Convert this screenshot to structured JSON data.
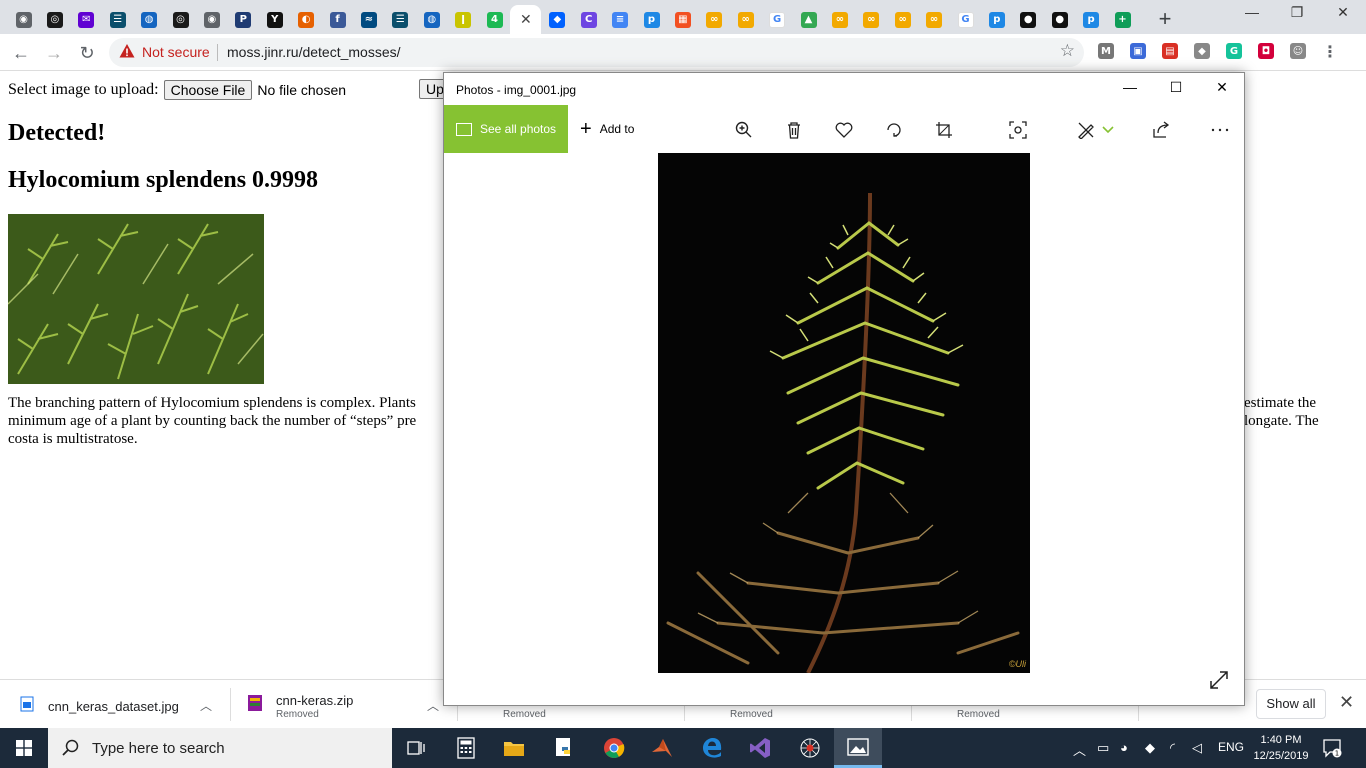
{
  "browser": {
    "tabs": [
      {
        "icon": "globe-icon",
        "color": "#5f6368",
        "glyph": "◉"
      },
      {
        "icon": "camera-lens-icon",
        "color": "#1a1a1a",
        "glyph": "◎"
      },
      {
        "icon": "mail-icon",
        "color": "#6001d2",
        "glyph": "✉"
      },
      {
        "icon": "ice-icon",
        "color": "#0b4f6c",
        "glyph": "☰"
      },
      {
        "icon": "earth-icon",
        "color": "#1565c0",
        "glyph": "◍"
      },
      {
        "icon": "camera-lens-icon",
        "color": "#1a1a1a",
        "glyph": "◎"
      },
      {
        "icon": "globe-icon",
        "color": "#5f6368",
        "glyph": "◉"
      },
      {
        "icon": "p-icon",
        "color": "#1f3b73",
        "glyph": "P"
      },
      {
        "icon": "y-icon",
        "color": "#111111",
        "glyph": "Y"
      },
      {
        "icon": "firefox-icon",
        "color": "#e66000",
        "glyph": "◐"
      },
      {
        "icon": "facebook-icon",
        "color": "#3b5998",
        "glyph": "f"
      },
      {
        "icon": "ship-icon",
        "color": "#004a80",
        "glyph": "≈"
      },
      {
        "icon": "ice-icon",
        "color": "#0b4f6c",
        "glyph": "☰"
      },
      {
        "icon": "earth-icon",
        "color": "#1565c0",
        "glyph": "◍"
      },
      {
        "icon": "yellow-icon",
        "color": "#c9c400",
        "glyph": "ǀ"
      },
      {
        "icon": "sheets-icon",
        "color": "#1db954",
        "glyph": "4"
      },
      {
        "icon": "close-icon",
        "color": "#ffffff",
        "glyph": "✕"
      },
      {
        "icon": "dropbox-icon",
        "color": "#0061fe",
        "glyph": "◆"
      },
      {
        "icon": "c-icon",
        "color": "#6e45e2",
        "glyph": "C"
      },
      {
        "icon": "docs-icon",
        "color": "#4285f4",
        "glyph": "≡"
      },
      {
        "icon": "p-blue-icon",
        "color": "#1e88e5",
        "glyph": "p"
      },
      {
        "icon": "microsoft-icon",
        "color": "#f25022",
        "glyph": "▦"
      },
      {
        "icon": "infinity-icon",
        "color": "#f2a900",
        "glyph": "∞"
      },
      {
        "icon": "infinity-icon",
        "color": "#f2a900",
        "glyph": "∞"
      },
      {
        "icon": "google-icon",
        "color": "#ffffff",
        "glyph": "G"
      },
      {
        "icon": "drive-icon",
        "color": "#34a853",
        "glyph": "▲"
      },
      {
        "icon": "infinity-icon",
        "color": "#f2a900",
        "glyph": "∞"
      },
      {
        "icon": "infinity-icon",
        "color": "#f2a900",
        "glyph": "∞"
      },
      {
        "icon": "infinity-icon",
        "color": "#f2a900",
        "glyph": "∞"
      },
      {
        "icon": "infinity-icon",
        "color": "#f2a900",
        "glyph": "∞"
      },
      {
        "icon": "google-icon",
        "color": "#ffffff",
        "glyph": "G"
      },
      {
        "icon": "p-blue-icon",
        "color": "#1e88e5",
        "glyph": "p"
      },
      {
        "icon": "github-icon",
        "color": "#111111",
        "glyph": "●"
      },
      {
        "icon": "github-icon",
        "color": "#111111",
        "glyph": "●"
      },
      {
        "icon": "p-blue-icon",
        "color": "#1e88e5",
        "glyph": "p"
      },
      {
        "icon": "plus-green-icon",
        "color": "#0f9d58",
        "glyph": "+"
      }
    ],
    "new_tab": "+",
    "window_controls": {
      "minimize": "—",
      "restore": "❐",
      "close": "✕"
    },
    "nav": {
      "back": "←",
      "forward": "→",
      "reload": "↻"
    },
    "security": "Not secure",
    "url": "moss.jinr.ru/detect_mosses/",
    "extensions": [
      {
        "icon": "m-icon",
        "color": "#777777",
        "glyph": "M"
      },
      {
        "icon": "camera-icon",
        "color": "#3c6ad8",
        "glyph": "▣"
      },
      {
        "icon": "red-ext-icon",
        "color": "#d93025",
        "glyph": "▤"
      },
      {
        "icon": "dropbox-icon",
        "color": "#888888",
        "glyph": "◆"
      },
      {
        "icon": "grammarly-icon",
        "color": "#15c39a",
        "glyph": "G"
      },
      {
        "icon": "pocket-icon",
        "color": "#d3003b",
        "glyph": "◘"
      },
      {
        "icon": "profile-icon",
        "color": "#888888",
        "glyph": "☺"
      },
      {
        "icon": "menu-icon",
        "color": "#5f6368",
        "glyph": "⋮"
      }
    ]
  },
  "page": {
    "upload_label": "Select image to upload:",
    "choose_file": "Choose File",
    "no_file": "No file chosen",
    "upload_button": "Up",
    "detected": "Detected!",
    "result": "Hylocomium splendens 0.9998",
    "description_left": "The branching pattern of Hylocomium splendens is complex. Plants",
    "description_left_2": "minimum age of a plant by counting back the number of “steps” pre",
    "description_left_3": "costa is multistratose.",
    "description_right_1": "estimate the",
    "description_right_2": "longate. The"
  },
  "downloads": {
    "items": [
      {
        "name": "cnn_keras_dataset.jpg",
        "sub": ""
      },
      {
        "name": "cnn-keras.zip",
        "sub": "Removed"
      },
      {
        "name": "",
        "sub": "Removed"
      },
      {
        "name": "",
        "sub": "Removed"
      },
      {
        "name": "",
        "sub": "Removed"
      }
    ],
    "show_all": "Show all",
    "close": "✕"
  },
  "photos": {
    "title": "Photos - img_0001.jpg",
    "see_all": "See all photos",
    "add_to": "Add to",
    "watermark": "©Uli",
    "controls": {
      "minimize": "—",
      "maximize": "☐",
      "close": "✕"
    }
  },
  "taskbar": {
    "search_placeholder": "Type here to search",
    "time": "1:40 PM",
    "date": "12/25/2019",
    "lang": "ENG",
    "colors": {
      "bg": "#1c2a3a",
      "accent": "#76b9ed"
    }
  }
}
